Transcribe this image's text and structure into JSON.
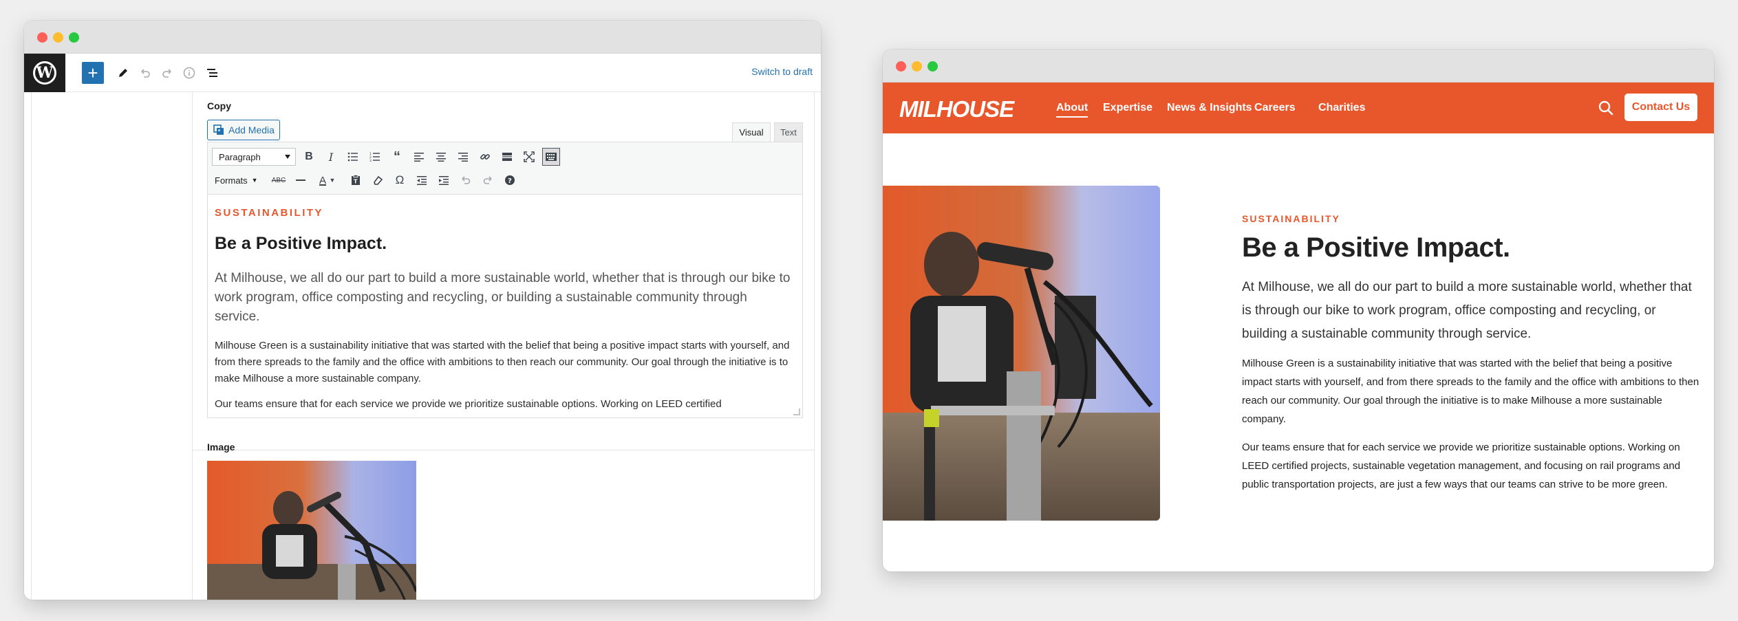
{
  "editor": {
    "toolbar": {
      "add_label": "+",
      "switch_draft": "Switch to draft"
    },
    "copy_label": "Copy",
    "add_media": "Add Media",
    "tabs": {
      "visual": "Visual",
      "text": "Text"
    },
    "format_select": "Paragraph",
    "formats_label": "Formats",
    "content": {
      "eyebrow": "SUSTAINABILITY",
      "heading": "Be a Positive Impact.",
      "lead": "At Milhouse, we all do our part to build a more sustainable world, whether that is through our bike to work program, office composting and recycling, or building a sustainable community through service.",
      "p1": "Milhouse Green is a sustainability initiative that was started with the belief that being a positive impact starts with yourself, and from there spreads to the family and the office with ambitions to then reach our community. Our goal through the initiative is to make Milhouse a more sustainable company.",
      "p2": "Our teams ensure that for each service we provide we prioritize sustainable options. Working on LEED certified"
    },
    "image_label": "Image"
  },
  "site": {
    "logo": "MILHOUSE",
    "nav": [
      "About",
      "Expertise",
      "News & Insights",
      "Careers",
      "Charities"
    ],
    "contact": "Contact Us",
    "eyebrow": "SUSTAINABILITY",
    "heading": "Be a Positive Impact.",
    "lead": "At Milhouse, we all do our part to build a more sustainable world, whether that is through our bike to work program, office composting and recycling, or building a sustainable community through service.",
    "p1": "Milhouse Green is a sustainability initiative that was started with the belief that being a positive impact starts with yourself, and from there spreads to the family and the office with ambitions to then reach our community. Our goal through the initiative is to make Milhouse a more sustainable company.",
    "p2": "Our teams ensure that for each service we provide we prioritize sustainable options. Working on LEED certified projects, sustainable vegetation management, and focusing on rail programs and public transportation projects, are just a few ways that our teams can strive to be more green."
  },
  "colors": {
    "brand": "#e8562c",
    "wp_blue": "#2271b1"
  }
}
